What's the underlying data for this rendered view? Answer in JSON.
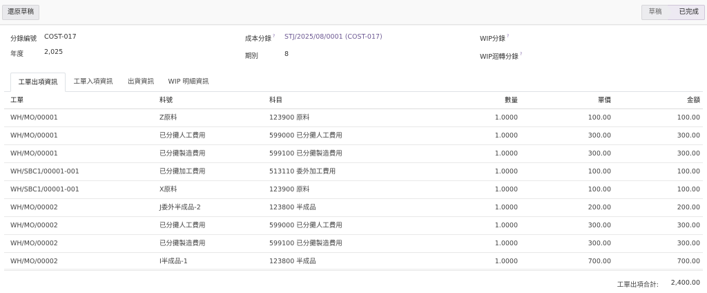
{
  "toolbar": {
    "reset_draft_label": "還原草稿",
    "stages": [
      {
        "label": "草稿",
        "active": false
      },
      {
        "label": "已完成",
        "active": true
      }
    ]
  },
  "form": {
    "entry_no_label": "分錄編號",
    "entry_no_value": "COST-017",
    "year_label": "年度",
    "year_value": "2,025",
    "cost_entry_label": "成本分錄",
    "cost_entry_help": "?",
    "cost_entry_value": "STJ/2025/08/0001 (COST-017)",
    "period_label": "期別",
    "period_value": "8",
    "wip_entry_label": "WIP分錄",
    "wip_entry_help": "?",
    "wip_reverse_label": "WIP迴轉分錄",
    "wip_reverse_help": "?"
  },
  "tabs": [
    {
      "label": "工單出項資訊",
      "active": true
    },
    {
      "label": "工單入項資訊",
      "active": false
    },
    {
      "label": "出貨資訊",
      "active": false
    },
    {
      "label": "WIP 明細資訊",
      "active": false
    }
  ],
  "table": {
    "columns": [
      "工單",
      "料號",
      "科目",
      "數量",
      "單價",
      "金額"
    ],
    "rows": [
      [
        "WH/MO/00001",
        "Z原料",
        "123900 原料",
        "1.0000",
        "100.00",
        "100.00"
      ],
      [
        "WH/MO/00001",
        "已分攤人工費用",
        "599000 已分攤人工費用",
        "1.0000",
        "300.00",
        "300.00"
      ],
      [
        "WH/MO/00001",
        "已分攤製造費用",
        "599100 已分攤製造費用",
        "1.0000",
        "300.00",
        "300.00"
      ],
      [
        "WH/SBC1/00001-001",
        "已分攤加工費用",
        "513110 委外加工費用",
        "1.0000",
        "100.00",
        "100.00"
      ],
      [
        "WH/SBC1/00001-001",
        "X原料",
        "123900 原料",
        "1.0000",
        "100.00",
        "100.00"
      ],
      [
        "WH/MO/00002",
        "J委外半成品-2",
        "123800 半成品",
        "1.0000",
        "200.00",
        "200.00"
      ],
      [
        "WH/MO/00002",
        "已分攤人工費用",
        "599000 已分攤人工費用",
        "1.0000",
        "300.00",
        "300.00"
      ],
      [
        "WH/MO/00002",
        "已分攤製造費用",
        "599100 已分攤製造費用",
        "1.0000",
        "300.00",
        "300.00"
      ],
      [
        "WH/MO/00002",
        "I半成品-1",
        "123800 半成品",
        "1.0000",
        "700.00",
        "700.00"
      ]
    ],
    "total_label": "工單出項合計:",
    "total_value": "2,400.00"
  }
}
